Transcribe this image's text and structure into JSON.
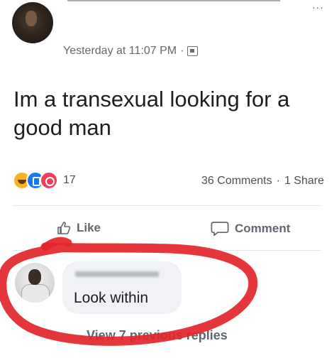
{
  "post": {
    "timestamp": "Yesterday at 11:07 PM",
    "separator": "·",
    "privacy_icon": "audience-icon",
    "more_icon": "ellipsis-icon",
    "more_label": "···",
    "text": "Im a transexual looking for a good man"
  },
  "reactions": {
    "icons": [
      "haha-icon",
      "like-reaction-icon",
      "love-icon"
    ],
    "count": "17",
    "comments": "36 Comments",
    "dot": "·",
    "shares": "1 Share"
  },
  "actions": {
    "like_label": "Like",
    "comment_label": "Comment"
  },
  "comment": {
    "text": "Look within"
  },
  "replies": {
    "label": "View 7 previous replies"
  },
  "colors": {
    "annotation_ring": "#e3262a",
    "facebook_blue": "#1877f2",
    "secondary_text": "#65676b"
  }
}
